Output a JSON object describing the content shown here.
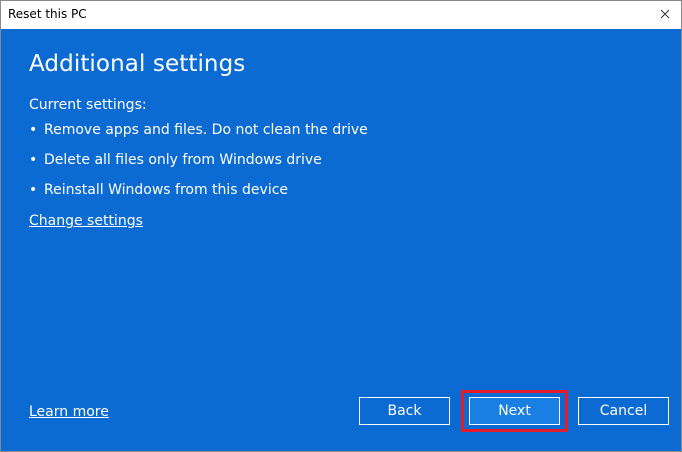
{
  "window": {
    "title": "Reset this PC",
    "close_icon": "close-icon"
  },
  "main": {
    "heading": "Additional settings",
    "current_label": "Current settings:",
    "bullet_char": "•",
    "settings": [
      "Remove apps and files. Do not clean the drive",
      "Delete all files only from Windows drive",
      "Reinstall Windows from this device"
    ],
    "change_link": "Change settings"
  },
  "footer": {
    "learn_more": "Learn more",
    "back_label": "Back",
    "next_label": "Next",
    "cancel_label": "Cancel"
  },
  "colors": {
    "background": "#0b6bd3",
    "highlight": "#e21c2b",
    "text": "#ffffff"
  }
}
